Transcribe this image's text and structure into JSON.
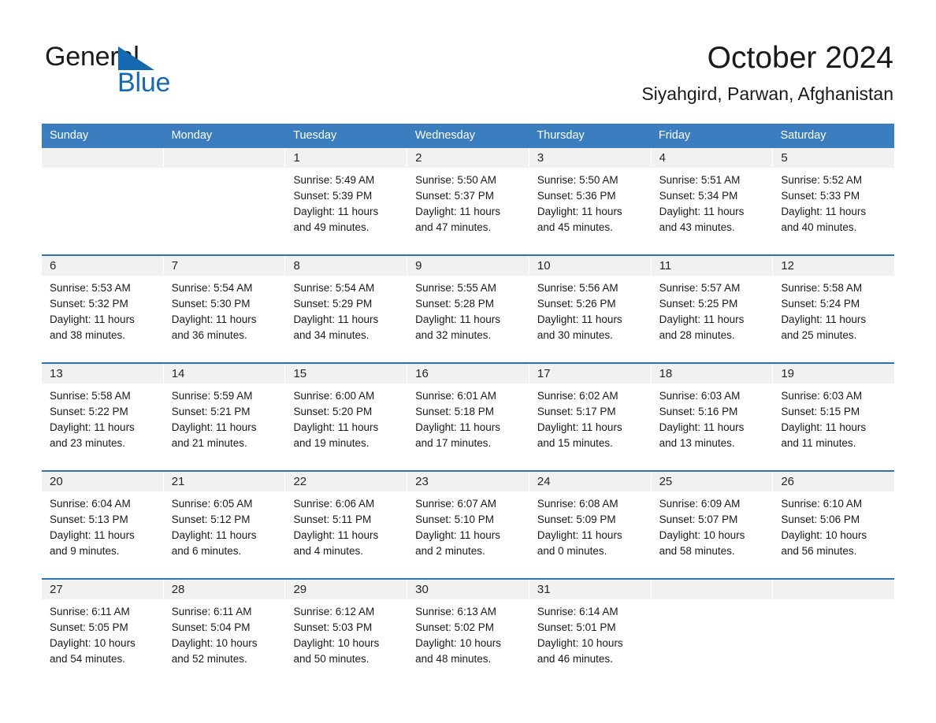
{
  "brand": {
    "name_part1": "General",
    "name_part2": "Blue",
    "triangle_color": "#1569b0",
    "text_color": "#1a1a1a"
  },
  "header": {
    "title": "October 2024",
    "subtitle": "Siyahgird, Parwan, Afghanistan"
  },
  "theme": {
    "header_blue": "#3b7ebf",
    "row_rule_blue": "#2e72b4",
    "date_strip_gray": "#f1f1f1",
    "page_background": "#ffffff"
  },
  "weekdays": [
    "Sunday",
    "Monday",
    "Tuesday",
    "Wednesday",
    "Thursday",
    "Friday",
    "Saturday"
  ],
  "weeks": [
    [
      {
        "day": "",
        "sunrise": "",
        "sunset": "",
        "daylight_line1": "",
        "daylight_line2": "",
        "empty": true
      },
      {
        "day": "",
        "sunrise": "",
        "sunset": "",
        "daylight_line1": "",
        "daylight_line2": "",
        "empty": true
      },
      {
        "day": "1",
        "sunrise": "Sunrise: 5:49 AM",
        "sunset": "Sunset: 5:39 PM",
        "daylight_line1": "Daylight: 11 hours",
        "daylight_line2": "and 49 minutes.",
        "empty": false
      },
      {
        "day": "2",
        "sunrise": "Sunrise: 5:50 AM",
        "sunset": "Sunset: 5:37 PM",
        "daylight_line1": "Daylight: 11 hours",
        "daylight_line2": "and 47 minutes.",
        "empty": false
      },
      {
        "day": "3",
        "sunrise": "Sunrise: 5:50 AM",
        "sunset": "Sunset: 5:36 PM",
        "daylight_line1": "Daylight: 11 hours",
        "daylight_line2": "and 45 minutes.",
        "empty": false
      },
      {
        "day": "4",
        "sunrise": "Sunrise: 5:51 AM",
        "sunset": "Sunset: 5:34 PM",
        "daylight_line1": "Daylight: 11 hours",
        "daylight_line2": "and 43 minutes.",
        "empty": false
      },
      {
        "day": "5",
        "sunrise": "Sunrise: 5:52 AM",
        "sunset": "Sunset: 5:33 PM",
        "daylight_line1": "Daylight: 11 hours",
        "daylight_line2": "and 40 minutes.",
        "empty": false
      }
    ],
    [
      {
        "day": "6",
        "sunrise": "Sunrise: 5:53 AM",
        "sunset": "Sunset: 5:32 PM",
        "daylight_line1": "Daylight: 11 hours",
        "daylight_line2": "and 38 minutes.",
        "empty": false
      },
      {
        "day": "7",
        "sunrise": "Sunrise: 5:54 AM",
        "sunset": "Sunset: 5:30 PM",
        "daylight_line1": "Daylight: 11 hours",
        "daylight_line2": "and 36 minutes.",
        "empty": false
      },
      {
        "day": "8",
        "sunrise": "Sunrise: 5:54 AM",
        "sunset": "Sunset: 5:29 PM",
        "daylight_line1": "Daylight: 11 hours",
        "daylight_line2": "and 34 minutes.",
        "empty": false
      },
      {
        "day": "9",
        "sunrise": "Sunrise: 5:55 AM",
        "sunset": "Sunset: 5:28 PM",
        "daylight_line1": "Daylight: 11 hours",
        "daylight_line2": "and 32 minutes.",
        "empty": false
      },
      {
        "day": "10",
        "sunrise": "Sunrise: 5:56 AM",
        "sunset": "Sunset: 5:26 PM",
        "daylight_line1": "Daylight: 11 hours",
        "daylight_line2": "and 30 minutes.",
        "empty": false
      },
      {
        "day": "11",
        "sunrise": "Sunrise: 5:57 AM",
        "sunset": "Sunset: 5:25 PM",
        "daylight_line1": "Daylight: 11 hours",
        "daylight_line2": "and 28 minutes.",
        "empty": false
      },
      {
        "day": "12",
        "sunrise": "Sunrise: 5:58 AM",
        "sunset": "Sunset: 5:24 PM",
        "daylight_line1": "Daylight: 11 hours",
        "daylight_line2": "and 25 minutes.",
        "empty": false
      }
    ],
    [
      {
        "day": "13",
        "sunrise": "Sunrise: 5:58 AM",
        "sunset": "Sunset: 5:22 PM",
        "daylight_line1": "Daylight: 11 hours",
        "daylight_line2": "and 23 minutes.",
        "empty": false
      },
      {
        "day": "14",
        "sunrise": "Sunrise: 5:59 AM",
        "sunset": "Sunset: 5:21 PM",
        "daylight_line1": "Daylight: 11 hours",
        "daylight_line2": "and 21 minutes.",
        "empty": false
      },
      {
        "day": "15",
        "sunrise": "Sunrise: 6:00 AM",
        "sunset": "Sunset: 5:20 PM",
        "daylight_line1": "Daylight: 11 hours",
        "daylight_line2": "and 19 minutes.",
        "empty": false
      },
      {
        "day": "16",
        "sunrise": "Sunrise: 6:01 AM",
        "sunset": "Sunset: 5:18 PM",
        "daylight_line1": "Daylight: 11 hours",
        "daylight_line2": "and 17 minutes.",
        "empty": false
      },
      {
        "day": "17",
        "sunrise": "Sunrise: 6:02 AM",
        "sunset": "Sunset: 5:17 PM",
        "daylight_line1": "Daylight: 11 hours",
        "daylight_line2": "and 15 minutes.",
        "empty": false
      },
      {
        "day": "18",
        "sunrise": "Sunrise: 6:03 AM",
        "sunset": "Sunset: 5:16 PM",
        "daylight_line1": "Daylight: 11 hours",
        "daylight_line2": "and 13 minutes.",
        "empty": false
      },
      {
        "day": "19",
        "sunrise": "Sunrise: 6:03 AM",
        "sunset": "Sunset: 5:15 PM",
        "daylight_line1": "Daylight: 11 hours",
        "daylight_line2": "and 11 minutes.",
        "empty": false
      }
    ],
    [
      {
        "day": "20",
        "sunrise": "Sunrise: 6:04 AM",
        "sunset": "Sunset: 5:13 PM",
        "daylight_line1": "Daylight: 11 hours",
        "daylight_line2": "and 9 minutes.",
        "empty": false
      },
      {
        "day": "21",
        "sunrise": "Sunrise: 6:05 AM",
        "sunset": "Sunset: 5:12 PM",
        "daylight_line1": "Daylight: 11 hours",
        "daylight_line2": "and 6 minutes.",
        "empty": false
      },
      {
        "day": "22",
        "sunrise": "Sunrise: 6:06 AM",
        "sunset": "Sunset: 5:11 PM",
        "daylight_line1": "Daylight: 11 hours",
        "daylight_line2": "and 4 minutes.",
        "empty": false
      },
      {
        "day": "23",
        "sunrise": "Sunrise: 6:07 AM",
        "sunset": "Sunset: 5:10 PM",
        "daylight_line1": "Daylight: 11 hours",
        "daylight_line2": "and 2 minutes.",
        "empty": false
      },
      {
        "day": "24",
        "sunrise": "Sunrise: 6:08 AM",
        "sunset": "Sunset: 5:09 PM",
        "daylight_line1": "Daylight: 11 hours",
        "daylight_line2": "and 0 minutes.",
        "empty": false
      },
      {
        "day": "25",
        "sunrise": "Sunrise: 6:09 AM",
        "sunset": "Sunset: 5:07 PM",
        "daylight_line1": "Daylight: 10 hours",
        "daylight_line2": "and 58 minutes.",
        "empty": false
      },
      {
        "day": "26",
        "sunrise": "Sunrise: 6:10 AM",
        "sunset": "Sunset: 5:06 PM",
        "daylight_line1": "Daylight: 10 hours",
        "daylight_line2": "and 56 minutes.",
        "empty": false
      }
    ],
    [
      {
        "day": "27",
        "sunrise": "Sunrise: 6:11 AM",
        "sunset": "Sunset: 5:05 PM",
        "daylight_line1": "Daylight: 10 hours",
        "daylight_line2": "and 54 minutes.",
        "empty": false
      },
      {
        "day": "28",
        "sunrise": "Sunrise: 6:11 AM",
        "sunset": "Sunset: 5:04 PM",
        "daylight_line1": "Daylight: 10 hours",
        "daylight_line2": "and 52 minutes.",
        "empty": false
      },
      {
        "day": "29",
        "sunrise": "Sunrise: 6:12 AM",
        "sunset": "Sunset: 5:03 PM",
        "daylight_line1": "Daylight: 10 hours",
        "daylight_line2": "and 50 minutes.",
        "empty": false
      },
      {
        "day": "30",
        "sunrise": "Sunrise: 6:13 AM",
        "sunset": "Sunset: 5:02 PM",
        "daylight_line1": "Daylight: 10 hours",
        "daylight_line2": "and 48 minutes.",
        "empty": false
      },
      {
        "day": "31",
        "sunrise": "Sunrise: 6:14 AM",
        "sunset": "Sunset: 5:01 PM",
        "daylight_line1": "Daylight: 10 hours",
        "daylight_line2": "and 46 minutes.",
        "empty": false
      },
      {
        "day": "",
        "sunrise": "",
        "sunset": "",
        "daylight_line1": "",
        "daylight_line2": "",
        "empty": true,
        "blank": true
      },
      {
        "day": "",
        "sunrise": "",
        "sunset": "",
        "daylight_line1": "",
        "daylight_line2": "",
        "empty": true,
        "blank": true
      }
    ]
  ]
}
